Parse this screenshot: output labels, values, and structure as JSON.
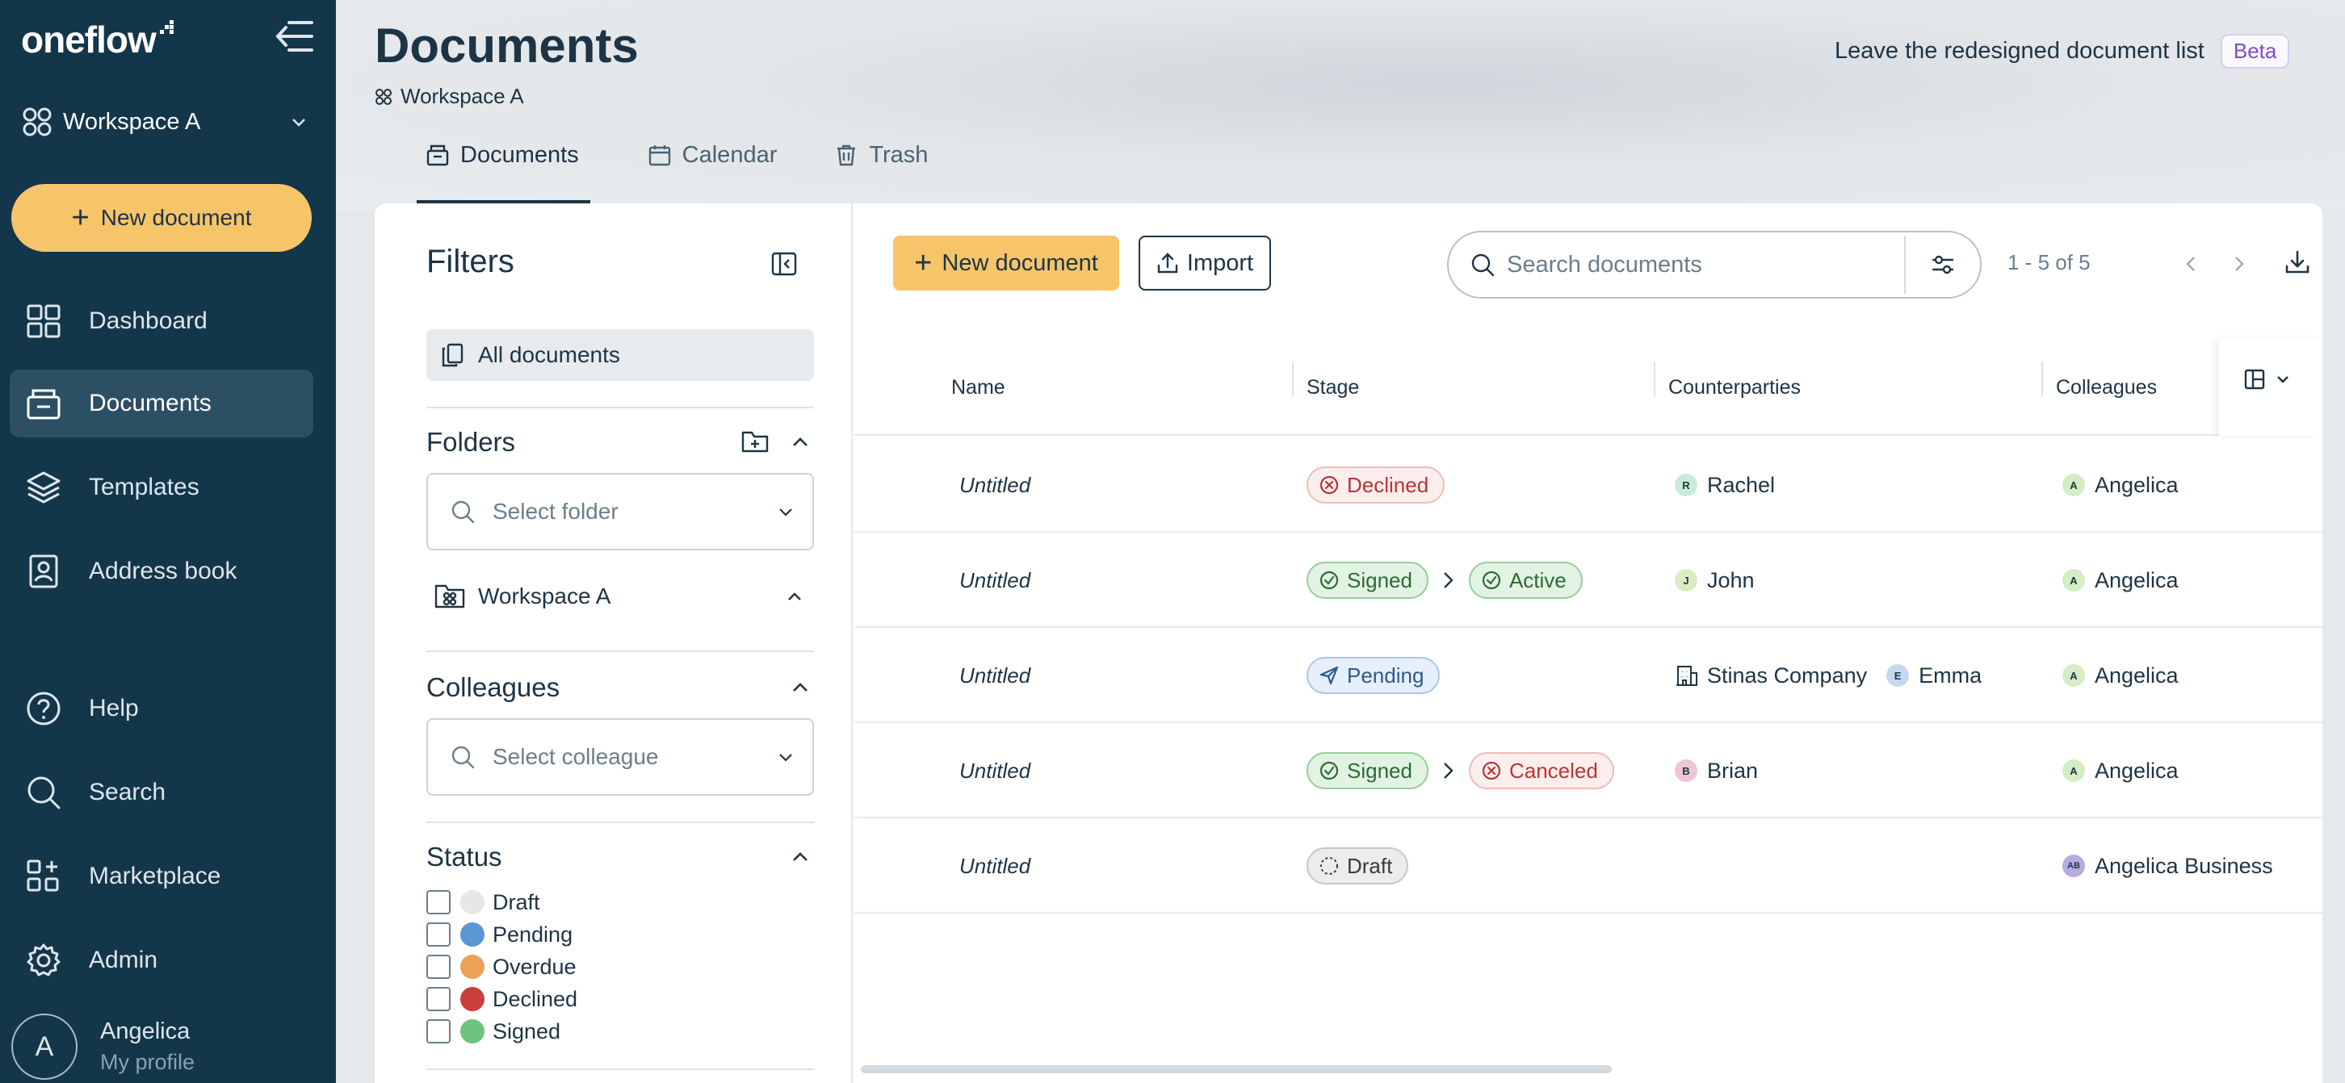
{
  "sidebar": {
    "logo": "oneflow",
    "workspace": "Workspace A",
    "new_document": "New document",
    "nav": [
      {
        "label": "Dashboard",
        "icon": "dashboard-icon"
      },
      {
        "label": "Documents",
        "icon": "documents-icon",
        "active": true
      },
      {
        "label": "Templates",
        "icon": "templates-icon"
      },
      {
        "label": "Address book",
        "icon": "address-book-icon"
      },
      {
        "label": "Help",
        "icon": "help-icon"
      },
      {
        "label": "Search",
        "icon": "search-icon"
      },
      {
        "label": "Marketplace",
        "icon": "marketplace-icon"
      },
      {
        "label": "Admin",
        "icon": "gear-icon"
      }
    ],
    "profile": {
      "initial": "A",
      "name": "Angelica",
      "sub": "My profile"
    }
  },
  "header": {
    "title": "Documents",
    "breadcrumb": "Workspace A",
    "leave_link": "Leave the redesigned document list",
    "beta": "Beta",
    "tabs": [
      {
        "label": "Documents",
        "active": true
      },
      {
        "label": "Calendar"
      },
      {
        "label": "Trash"
      }
    ]
  },
  "filters": {
    "title": "Filters",
    "all_documents": "All documents",
    "folders": {
      "title": "Folders",
      "placeholder": "Select folder",
      "root": "Workspace A"
    },
    "colleagues": {
      "title": "Colleagues",
      "placeholder": "Select colleague"
    },
    "status": {
      "title": "Status",
      "items": [
        {
          "label": "Draft",
          "color": "#e5e7e9"
        },
        {
          "label": "Pending",
          "color": "#5b95d3"
        },
        {
          "label": "Overdue",
          "color": "#e9a257"
        },
        {
          "label": "Declined",
          "color": "#cc3d3d"
        },
        {
          "label": "Signed",
          "color": "#6dc47f"
        }
      ]
    }
  },
  "toolbar": {
    "new_document": "New document",
    "import": "Import",
    "search_placeholder": "Search documents",
    "pagination": "1 - 5 of 5"
  },
  "table": {
    "columns": [
      "Name",
      "Stage",
      "Counterparties",
      "Colleagues"
    ],
    "rows": [
      {
        "name": "Untitled",
        "stages": [
          {
            "label": "Declined",
            "type": "declined"
          }
        ],
        "counterparties": [
          {
            "type": "person",
            "initial": "R",
            "name": "Rachel",
            "color": "#c9ebd9"
          }
        ],
        "colleague": {
          "initial": "A",
          "name": "Angelica",
          "color": "#d3edc4"
        }
      },
      {
        "name": "Untitled",
        "stages": [
          {
            "label": "Signed",
            "type": "signed"
          },
          {
            "label": "Active",
            "type": "active"
          }
        ],
        "counterparties": [
          {
            "type": "person",
            "initial": "J",
            "name": "John",
            "color": "#dbecc0"
          }
        ],
        "colleague": {
          "initial": "A",
          "name": "Angelica",
          "color": "#d3edc4"
        }
      },
      {
        "name": "Untitled",
        "stages": [
          {
            "label": "Pending",
            "type": "pending"
          }
        ],
        "counterparties": [
          {
            "type": "company",
            "name": "Stinas Company"
          },
          {
            "type": "person",
            "initial": "E",
            "name": "Emma",
            "color": "#c4d9ef"
          }
        ],
        "colleague": {
          "initial": "A",
          "name": "Angelica",
          "color": "#d3edc4"
        }
      },
      {
        "name": "Untitled",
        "stages": [
          {
            "label": "Signed",
            "type": "signed"
          },
          {
            "label": "Canceled",
            "type": "canceled"
          }
        ],
        "counterparties": [
          {
            "type": "person",
            "initial": "B",
            "name": "Brian",
            "color": "#efc4d3"
          }
        ],
        "colleague": {
          "initial": "A",
          "name": "Angelica",
          "color": "#d3edc4"
        }
      },
      {
        "name": "Untitled",
        "stages": [
          {
            "label": "Draft",
            "type": "draft"
          }
        ],
        "counterparties": [],
        "colleague": {
          "initial": "AB",
          "name": "Angelica Business",
          "color": "#b6abe3"
        }
      }
    ]
  }
}
